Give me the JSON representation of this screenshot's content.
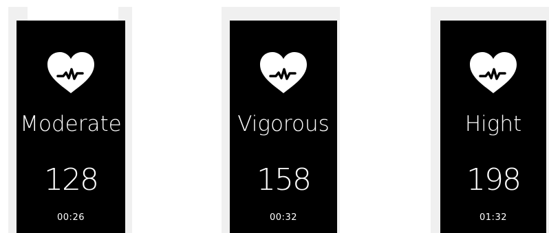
{
  "cards": [
    {
      "zone": "Moderate",
      "bpm": "128",
      "duration": "00:26",
      "icon": "heart-pulse-icon"
    },
    {
      "zone": "Vigorous",
      "bpm": "158",
      "duration": "00:32",
      "icon": "heart-pulse-icon"
    },
    {
      "zone": "Hight",
      "bpm": "198",
      "duration": "01:32",
      "icon": "heart-pulse-icon"
    }
  ],
  "colors": {
    "card_bg": "#000000",
    "text": "#ffffff",
    "strip": "#f0f0f0",
    "page": "#ffffff"
  }
}
